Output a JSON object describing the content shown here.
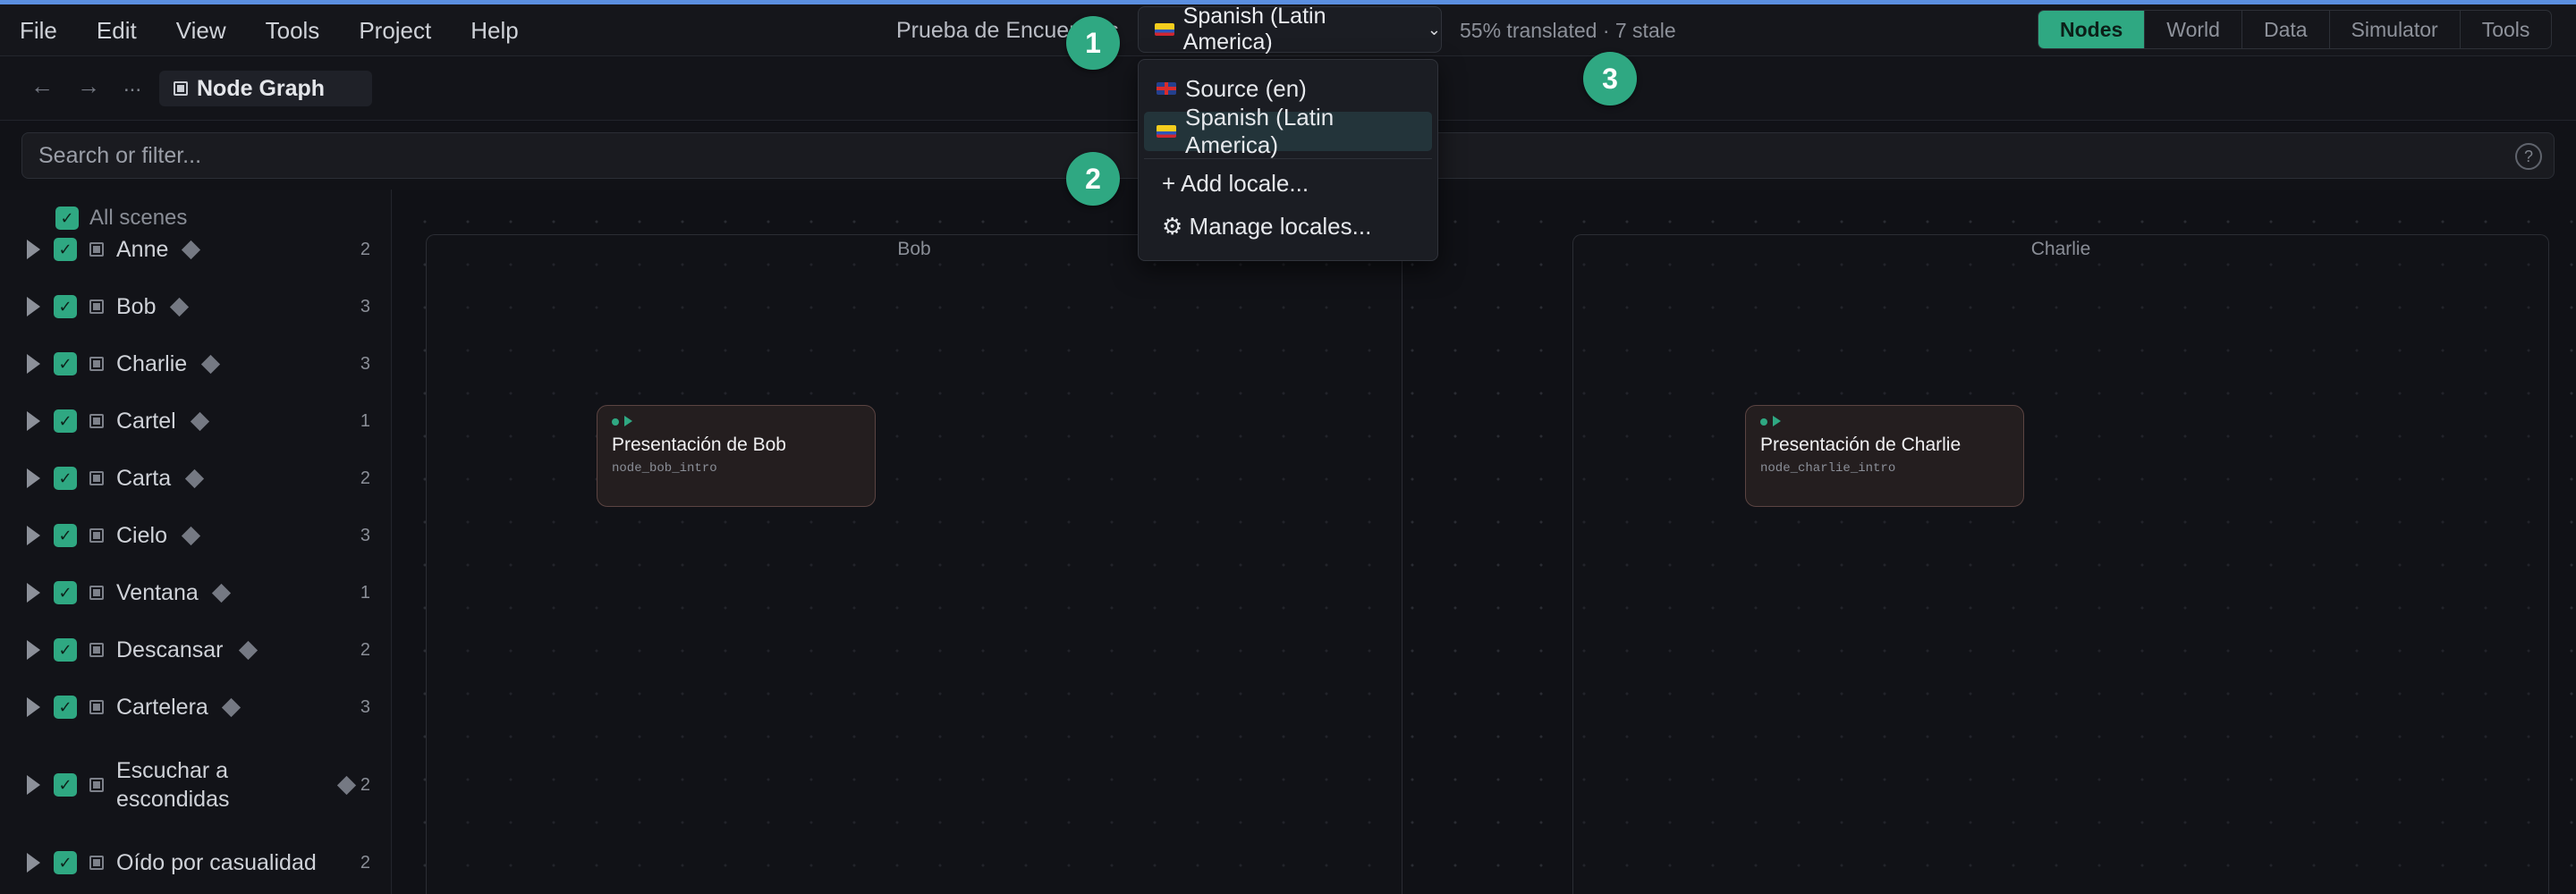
{
  "menu": [
    "File",
    "Edit",
    "View",
    "Tools",
    "Project",
    "Help"
  ],
  "project_name": "Prueba de Encuentros",
  "locale_selector": {
    "current": "Spanish (Latin America)"
  },
  "translation_status": "55% translated · 7 stale",
  "mode_tabs": [
    "Nodes",
    "World",
    "Data",
    "Simulator",
    "Tools"
  ],
  "active_mode": "Nodes",
  "breadcrumb": {
    "ellipsis": "...",
    "current": "Node Graph"
  },
  "search": {
    "placeholder": "Search or filter...",
    "help": "?"
  },
  "sidebar": {
    "all_scenes": "All scenes",
    "scenes": [
      {
        "name": "Anne",
        "count": "2"
      },
      {
        "name": "Bob",
        "count": "3"
      },
      {
        "name": "Charlie",
        "count": "3"
      },
      {
        "name": "Cartel",
        "count": "1"
      },
      {
        "name": "Carta",
        "count": "2"
      },
      {
        "name": "Cielo",
        "count": "3"
      },
      {
        "name": "Ventana",
        "count": "1"
      },
      {
        "name": "Descansar",
        "count": "2"
      },
      {
        "name": "Cartelera",
        "count": "3"
      },
      {
        "name": "Escuchar a escondidas",
        "count": "2"
      },
      {
        "name": "Oído por casualidad",
        "count": "2"
      }
    ]
  },
  "canvas": {
    "groups": [
      {
        "title": "Bob",
        "node": {
          "title": "Presentación de Bob",
          "id": "node_bob_intro"
        }
      },
      {
        "title": "Charlie",
        "node": {
          "title": "Presentación de Charlie",
          "id": "node_charlie_intro"
        }
      }
    ]
  },
  "locale_dropdown": {
    "items": [
      "Source (en)",
      "Spanish (Latin America)"
    ],
    "actions": [
      "+ Add locale...",
      "⚙ Manage locales..."
    ]
  },
  "markers": [
    "1",
    "2",
    "3"
  ],
  "colors": {
    "accent": "#2fa882",
    "topline": "#5b8fe0",
    "node_border": "#5b4442"
  }
}
